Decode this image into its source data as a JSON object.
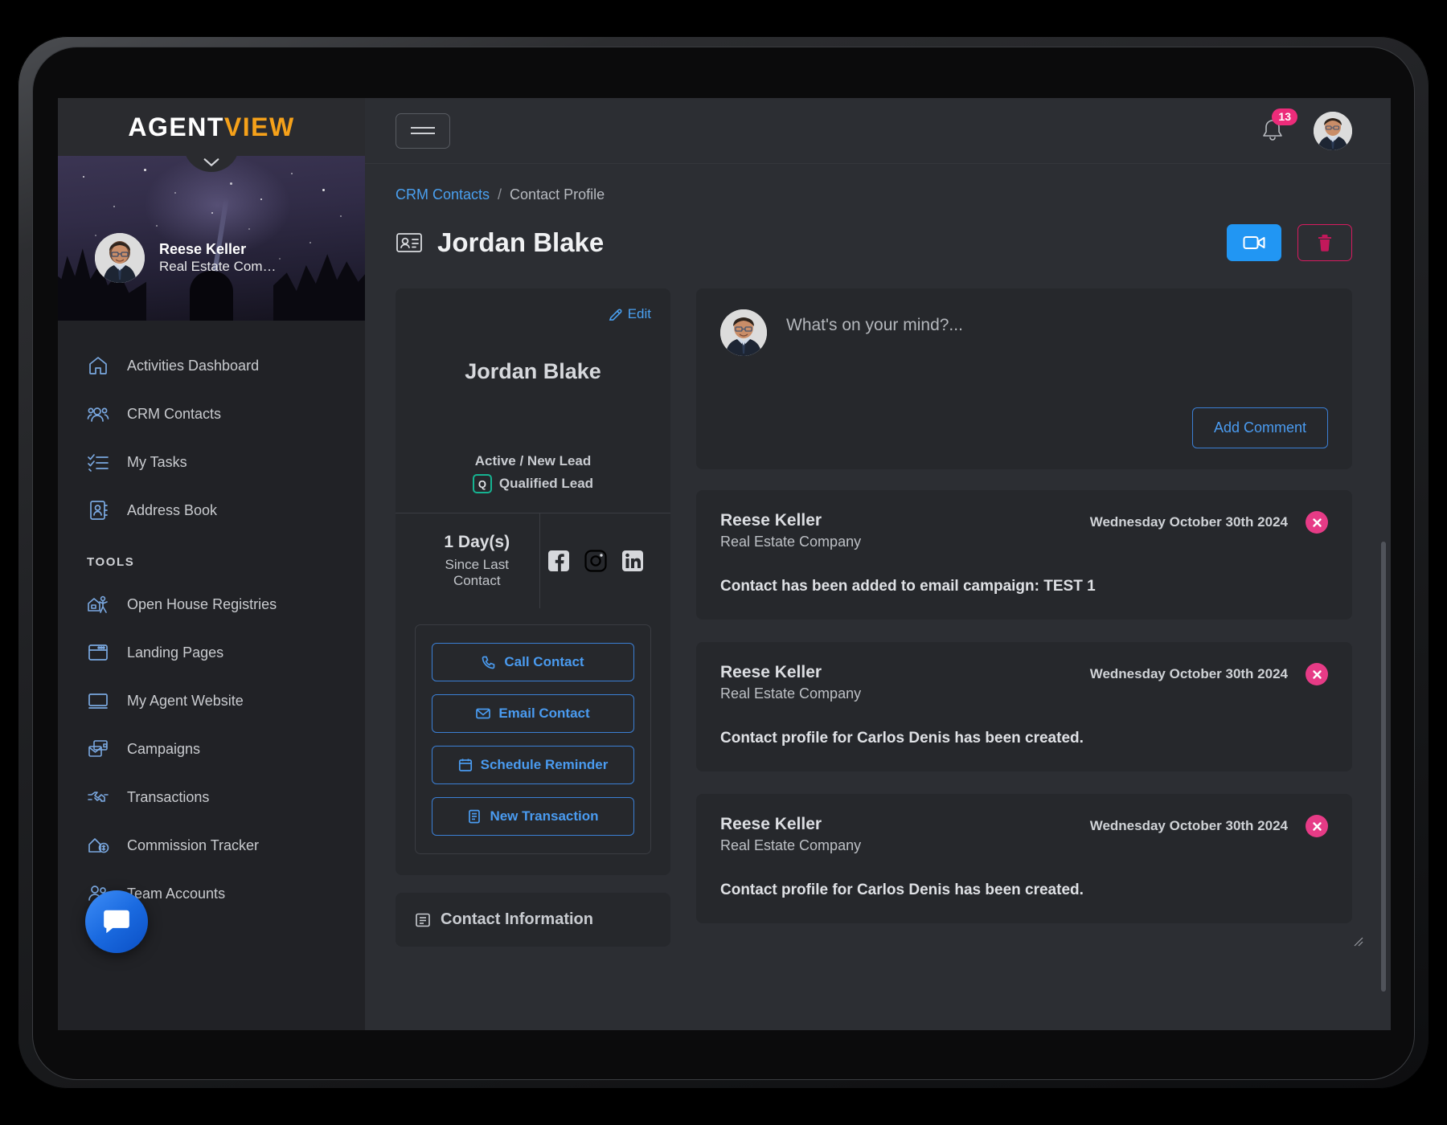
{
  "brand": {
    "part1": "AGENT",
    "part2": "VIEW",
    "accent_color": "#f5a11a"
  },
  "sidebar": {
    "profile": {
      "name": "Reese Keller",
      "role": "Real Estate Com…"
    },
    "items": [
      {
        "label": "Activities Dashboard",
        "icon": "home-icon"
      },
      {
        "label": "CRM Contacts",
        "icon": "users-icon"
      },
      {
        "label": "My Tasks",
        "icon": "checklist-icon"
      },
      {
        "label": "Address Book",
        "icon": "address-book-icon"
      }
    ],
    "section_label": "TOOLS",
    "tools": [
      {
        "label": "Open House Registries",
        "icon": "open-house-icon"
      },
      {
        "label": "Landing Pages",
        "icon": "browser-window-icon"
      },
      {
        "label": "My Agent Website",
        "icon": "monitor-icon"
      },
      {
        "label": "Campaigns",
        "icon": "campaign-mail-icon"
      },
      {
        "label": "Transactions",
        "icon": "handshake-icon"
      },
      {
        "label": "Commission Tracker",
        "icon": "commission-icon"
      },
      {
        "label": "Team Accounts",
        "icon": "team-icon"
      }
    ]
  },
  "topbar": {
    "notification_count": "13",
    "menu_icon": "hamburger-icon",
    "bell_icon": "bell-icon",
    "avatar": "user-avatar"
  },
  "breadcrumb": {
    "parent": "CRM Contacts",
    "separator": "/",
    "current": "Contact Profile"
  },
  "page": {
    "title": "Jordan Blake",
    "title_icon": "contact-card-icon",
    "video_button_icon": "video-camera-icon",
    "delete_button_icon": "trash-icon",
    "accent_blue": "#2196f3",
    "accent_pink": "#d81b60"
  },
  "contact_card": {
    "edit_label": "Edit",
    "edit_icon": "pencil-edit-icon",
    "name": "Jordan Blake",
    "status": "Active / New Lead",
    "qualified_badge": "Q",
    "qualified_label": "Qualified Lead",
    "qualified_color": "#16b391",
    "days_value": "1 Day(s)",
    "days_label": "Since Last Contact",
    "social": [
      {
        "name": "facebook-icon"
      },
      {
        "name": "instagram-icon"
      },
      {
        "name": "linkedin-icon"
      }
    ],
    "actions": [
      {
        "label": "Call Contact",
        "icon": "phone-icon"
      },
      {
        "label": "Email Contact",
        "icon": "envelope-icon"
      },
      {
        "label": "Schedule Reminder",
        "icon": "calendar-icon"
      },
      {
        "label": "New Transaction",
        "icon": "document-icon"
      }
    ],
    "info_section_title": "Contact Information",
    "info_section_icon": "info-list-icon"
  },
  "comment_box": {
    "placeholder": "What's on your mind?...",
    "submit_label": "Add Comment"
  },
  "feed": [
    {
      "author": "Reese Keller",
      "company": "Real Estate Company",
      "date": "Wednesday October 30th 2024",
      "body": "Contact has been added to email campaign: TEST 1",
      "close_icon": "close-circle-icon"
    },
    {
      "author": "Reese Keller",
      "company": "Real Estate Company",
      "date": "Wednesday October 30th 2024",
      "body": "Contact profile for Carlos Denis has been created.",
      "close_icon": "close-circle-icon"
    },
    {
      "author": "Reese Keller",
      "company": "Real Estate Company",
      "date": "Wednesday October 30th 2024",
      "body": "Contact profile for Carlos Denis has been created.",
      "close_icon": "close-circle-icon"
    }
  ],
  "chat_widget": {
    "icon": "chat-bubble-icon"
  }
}
